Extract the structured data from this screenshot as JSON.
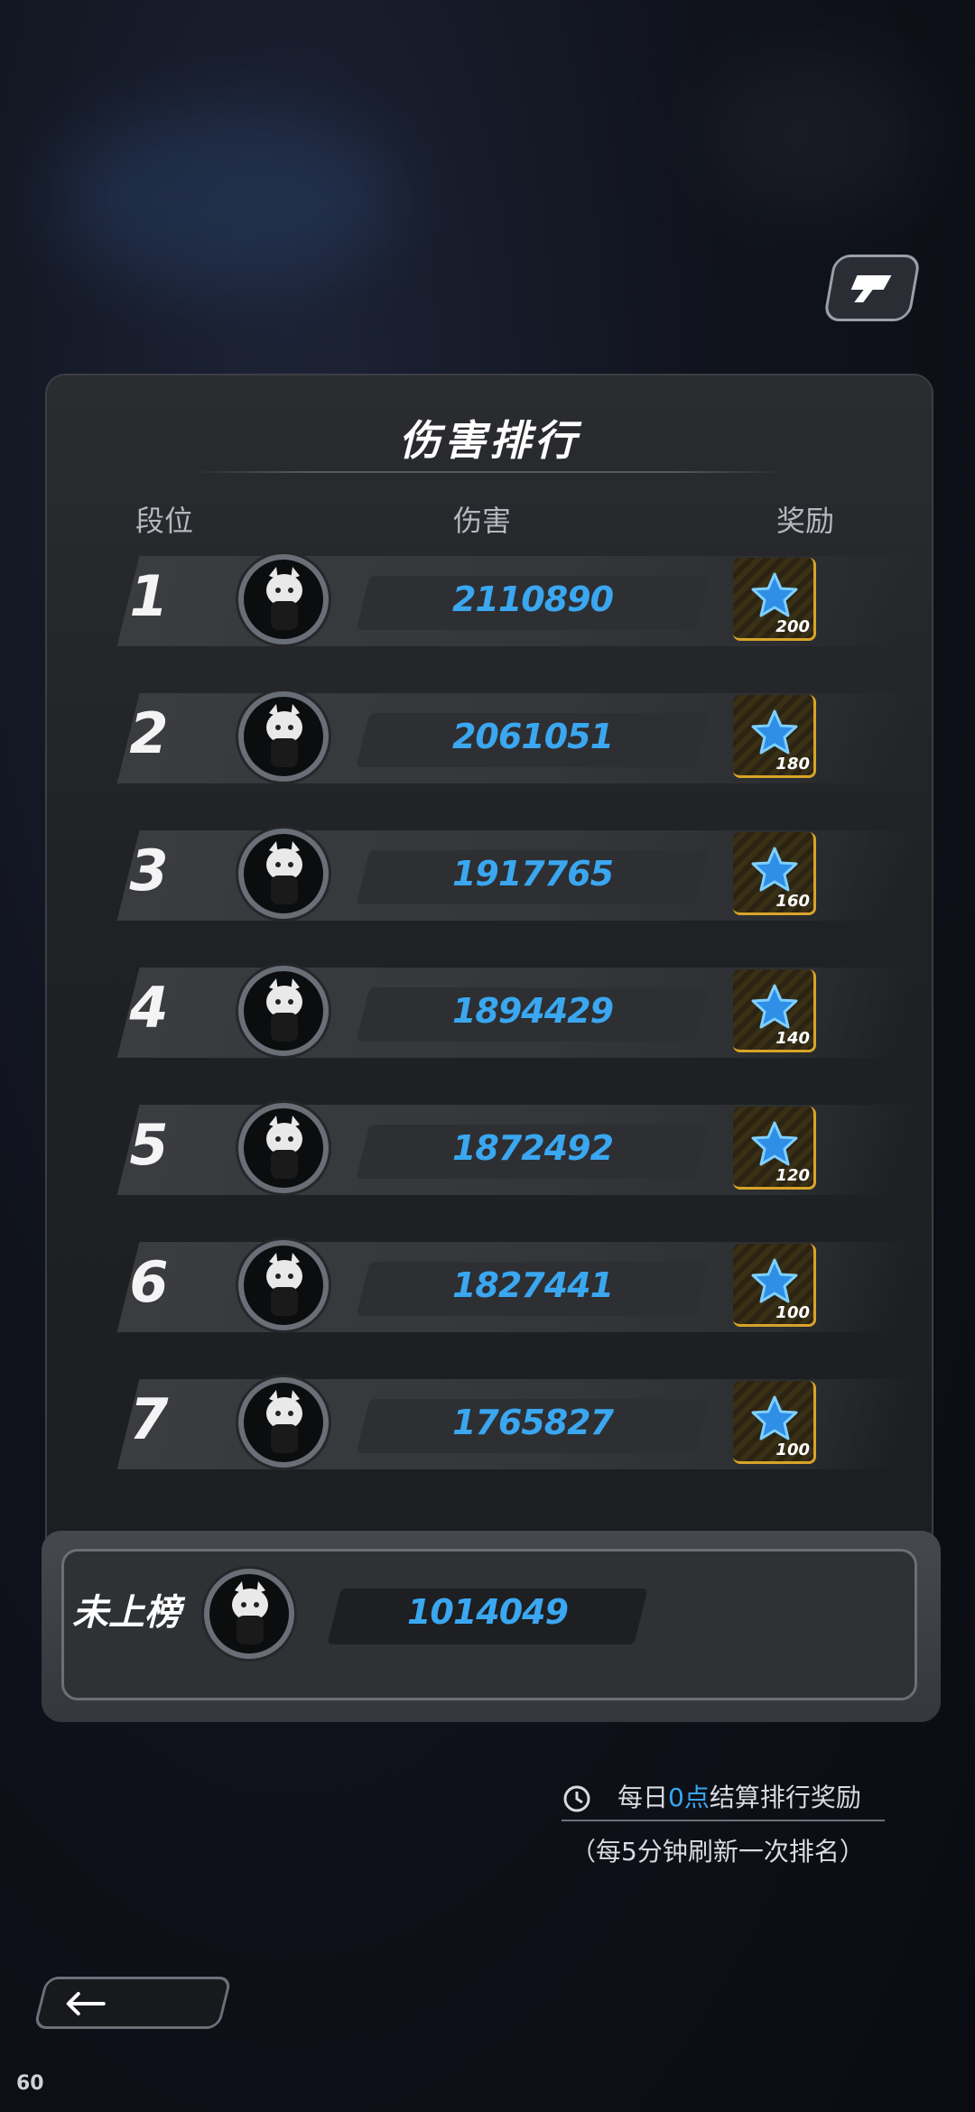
{
  "title": "伤害排行",
  "headers": {
    "rank": "段位",
    "damage": "伤害",
    "reward": "奖励"
  },
  "rows": [
    {
      "rank": "1",
      "damage": "2110890",
      "reward": "200"
    },
    {
      "rank": "2",
      "damage": "2061051",
      "reward": "180"
    },
    {
      "rank": "3",
      "damage": "1917765",
      "reward": "160"
    },
    {
      "rank": "4",
      "damage": "1894429",
      "reward": "140"
    },
    {
      "rank": "5",
      "damage": "1872492",
      "reward": "120"
    },
    {
      "rank": "6",
      "damage": "1827441",
      "reward": "100"
    },
    {
      "rank": "7",
      "damage": "1765827",
      "reward": "100"
    }
  ],
  "mine": {
    "label": "未上榜",
    "damage": "1014049"
  },
  "notes": {
    "prefix": "每日",
    "highlight": "0点",
    "suffix": "结算排行奖励",
    "refresh": "（每5分钟刷新一次排名）"
  },
  "fps": "60",
  "colors": {
    "accent": "#3aa7f0",
    "reward_border": "#d8a428"
  },
  "icons": {
    "share": "share-icon",
    "clock": "clock-icon",
    "back": "arrow-left-icon",
    "reward": "blue-star-icon"
  }
}
